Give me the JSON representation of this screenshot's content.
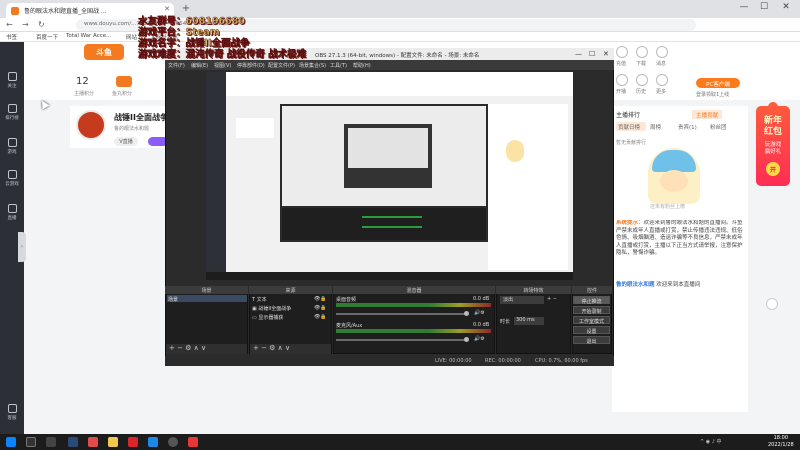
{
  "browser": {
    "tab_title": "鲁的眼法水和题直播_全国战 ...",
    "tab_close": "✕",
    "new_tab": "+",
    "url": "www.douyu.com/...7937467_r=0.6548794129641786",
    "nav": {
      "back": "←",
      "forward": "→",
      "reload": "↻"
    },
    "bookmarks": [
      "书签",
      "百度一下",
      "Total War Acce...",
      "网站",
      "网址导航"
    ],
    "window": {
      "min": "—",
      "max": "☐",
      "close": "✕"
    }
  },
  "overlay": {
    "line1": "水友群号：608196680",
    "line2": "游戏平台：Steam",
    "line3": "游戏名字：战锤II全面战争",
    "line4": "游戏难度：混沌传奇 战役传奇 战术极难"
  },
  "site": {
    "leftnav": [
      "关注",
      "排行榜",
      "游戏",
      "云游戏",
      "直播",
      "客服"
    ],
    "header_count": "12",
    "header_count_label": "主播积分",
    "header_icon_label": "鱼丸积分",
    "right_header": [
      "充值",
      "下载",
      "消息",
      "开播",
      "历史",
      "更多"
    ],
    "pc_button": "PC客户端",
    "pc_sub": "登录领取1上线",
    "stream_title": "战锤II全面战争",
    "stream_sub": "鲁的眼法水和题",
    "stream_badge": "V直播",
    "panel_head": "主播排行",
    "panel_head2": "主播贡献",
    "panel_tabs": [
      "贡献日榜",
      "周榜",
      "贵宾(1)",
      "粉丝团"
    ],
    "panel_small": "暂无贡献排行",
    "mascot_caption": "还未有粉丝上榜",
    "chat_label": "系统提示：",
    "chat_text": "欢迎来到鲁的眼法水和题的直播间。斗鱼严禁未成年人直播或打赏，禁止传播违法违规、低俗色情、吸烟酗酒、造谣诈骗等不良信息，严禁未成年人直播或打赏，主播以下正当方式请举报，注意保护隐私，警惕诈骗。",
    "chat2_user": "鲁的眼法水和题",
    "chat2_text": " 欢迎来到本直播间",
    "redpacket": {
      "title1": "新年",
      "title2": "红包",
      "sub1": "玩游戏",
      "sub2": "赢好礼",
      "btn": "开"
    }
  },
  "obs": {
    "title": "OBS 27.1.3 (64-bit, windows) - 配置文件: 未命名 - 场景: 未命名",
    "menu": [
      "文件(F)",
      "编辑(E)",
      "视图(V)",
      "停靠部件(D)",
      "配置文件(P)",
      "场景集合(S)",
      "工具(T)",
      "帮助(H)"
    ],
    "docks": {
      "scenes": {
        "header": "场景",
        "items": [
          "场景"
        ]
      },
      "sources": {
        "header": "来源",
        "items": [
          "文本",
          "战锤II全面战争",
          "显示器捕获"
        ]
      },
      "mixer": {
        "header": "混音器",
        "tracks": [
          {
            "name": "桌面音频",
            "db": "0.0 dB"
          },
          {
            "name": "麦克风/Aux",
            "db": "0.0 dB"
          }
        ]
      },
      "transitions": {
        "header": "转场特效",
        "type": "淡出",
        "duration_label": "时长",
        "duration": "300 ms"
      },
      "controls": {
        "header": "控件",
        "buttons": [
          "停止推流",
          "开始录制",
          "工作室模式",
          "设置",
          "退出"
        ]
      }
    },
    "footer_icons": "+ − ⚙ ∧ ∨",
    "status": {
      "live": "LIVE: 00:00:00",
      "rec": "REC: 00:00:00",
      "cpu": "CPU: 0.7%, 60.00 fps"
    }
  },
  "taskbar": {
    "time": "18:00",
    "date": "2022/1/28",
    "tray": "^ ◉ ♪ 中"
  }
}
